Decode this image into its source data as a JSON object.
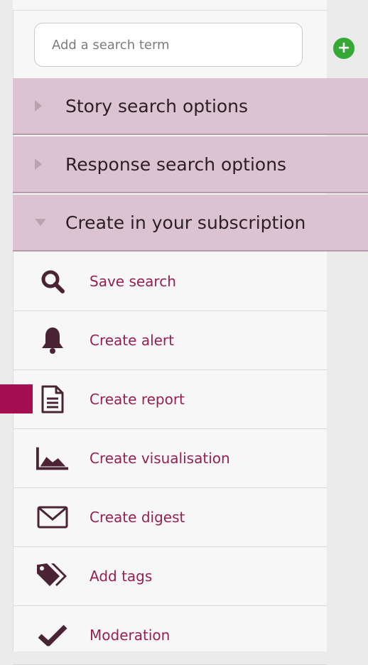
{
  "search": {
    "placeholder": "Add a search term",
    "add_icon": "plus-circle-icon"
  },
  "sections": [
    {
      "label": "Story search options",
      "state": "collapsed"
    },
    {
      "label": "Response search options",
      "state": "collapsed"
    },
    {
      "label": "Create in your subscription",
      "state": "expanded"
    }
  ],
  "items": [
    {
      "label": "Save search",
      "icon": "search-icon"
    },
    {
      "label": "Create alert",
      "icon": "bell-icon"
    },
    {
      "label": "Create report",
      "icon": "document-icon"
    },
    {
      "label": "Create visualisation",
      "icon": "area-chart-icon"
    },
    {
      "label": "Create digest",
      "icon": "envelope-icon"
    },
    {
      "label": "Add tags",
      "icon": "tags-icon"
    },
    {
      "label": "Moderation",
      "icon": "checkmark-icon"
    }
  ],
  "colors": {
    "accent": "#96204f",
    "section_bg": "#dcc3d2",
    "icon": "#4a2434",
    "add": "#35a835",
    "marker": "#a50f52"
  }
}
